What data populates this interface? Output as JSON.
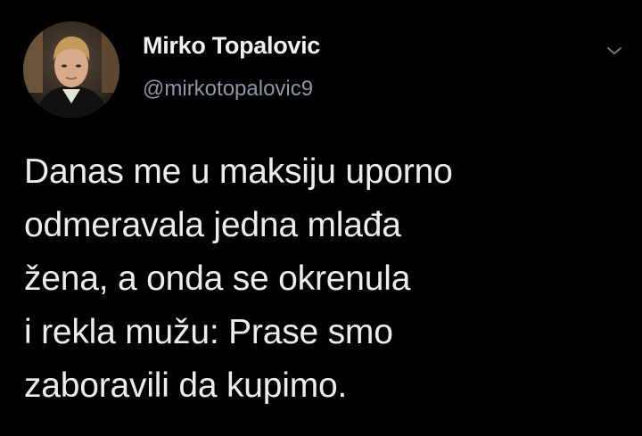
{
  "author": {
    "display_name": "Mirko Topalovic",
    "handle": "@mirkotopalovic9",
    "avatar_icon": "profile-photo"
  },
  "menu": {
    "icon": "chevron-down-icon"
  },
  "tweet": {
    "lines": [
      "Danas me u maksiju uporno",
      "odmeravala jedna mlađa",
      "žena, a onda se okrenula",
      "i rekla mužu: Prase smo",
      "zaboravili da kupimo."
    ]
  },
  "colors": {
    "background": "#000000",
    "text_primary": "#e7e9ea",
    "text_secondary": "#8b98a5"
  }
}
